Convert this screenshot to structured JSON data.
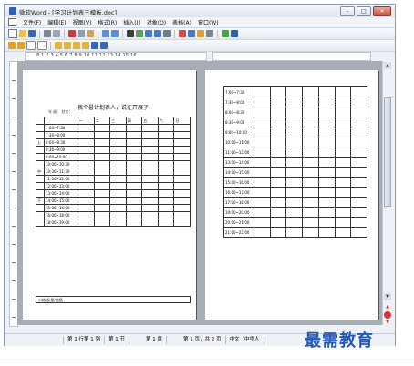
{
  "window": {
    "title": "微软Word - [学习计划表三模板.doc]",
    "buttons": {
      "minimize": "–",
      "maximize": "□",
      "close": "✕"
    }
  },
  "menu": [
    "文件(F)",
    "编辑(E)",
    "视图(V)",
    "格式(R)",
    "插入(I)",
    "对象(O)",
    "表格(A)",
    "窗口(W)"
  ],
  "ruler": {
    "numbers": "8 1 2 3 4 5 6 7 8 9 10 11 12 13 14 15 16"
  },
  "document": {
    "page1": {
      "title": "我个暑计划表人，说在开展了",
      "subtitle": "年      级：   姓名：",
      "header_cells": [
        "",
        "",
        "一",
        "二",
        "三",
        "四",
        "五",
        "六",
        "日"
      ],
      "rows": [
        {
          "side": "",
          "time": "7:00~7:30"
        },
        {
          "side": "",
          "time": "7:30~8:00"
        },
        {
          "side": "上",
          "time": "8:00~8:30"
        },
        {
          "side": "",
          "time": "8:30~9:00"
        },
        {
          "side": "",
          "time": "9:00~10:00"
        },
        {
          "side": "",
          "time": "10:00~10:30"
        },
        {
          "side": "中",
          "time": "10:30~11:30"
        },
        {
          "side": "",
          "time": "11:30~12:00"
        },
        {
          "side": "",
          "time": "12:00~13:00"
        },
        {
          "side": "",
          "time": "13:00~14:00"
        },
        {
          "side": "下",
          "time": "14:00~15:00"
        },
        {
          "side": "",
          "time": "15:00~16:00"
        },
        {
          "side": "",
          "time": "16:00~18:00"
        },
        {
          "side": "",
          "time": "18:00~19:00"
        }
      ],
      "memo_label": "小结/反思/感悟"
    },
    "page2": {
      "rows": [
        "7:00~7:30",
        "7:30~8:00",
        "8:00~8:30",
        "8:30~9:00",
        "9:00~10:00",
        "10:00~11:00",
        "11:00~12:00",
        "13:00~14:00",
        "14:00~15:00",
        "15:00~16:00",
        "16:00~17:00",
        "17:00~18:00",
        "19:00~20:00",
        "20:00~21:00",
        "21:00~22:00"
      ]
    }
  },
  "status": {
    "line_col": "第 1 行第 1 列",
    "section": "第 1 节",
    "chapter": "第 1 章",
    "page": "第 1 页，共 2 页",
    "language": "中文（中华人",
    "mode": "Ins"
  },
  "watermark": "最需教育",
  "colors": {
    "accent": "#2457b5",
    "workspace": "#a7adb5"
  }
}
